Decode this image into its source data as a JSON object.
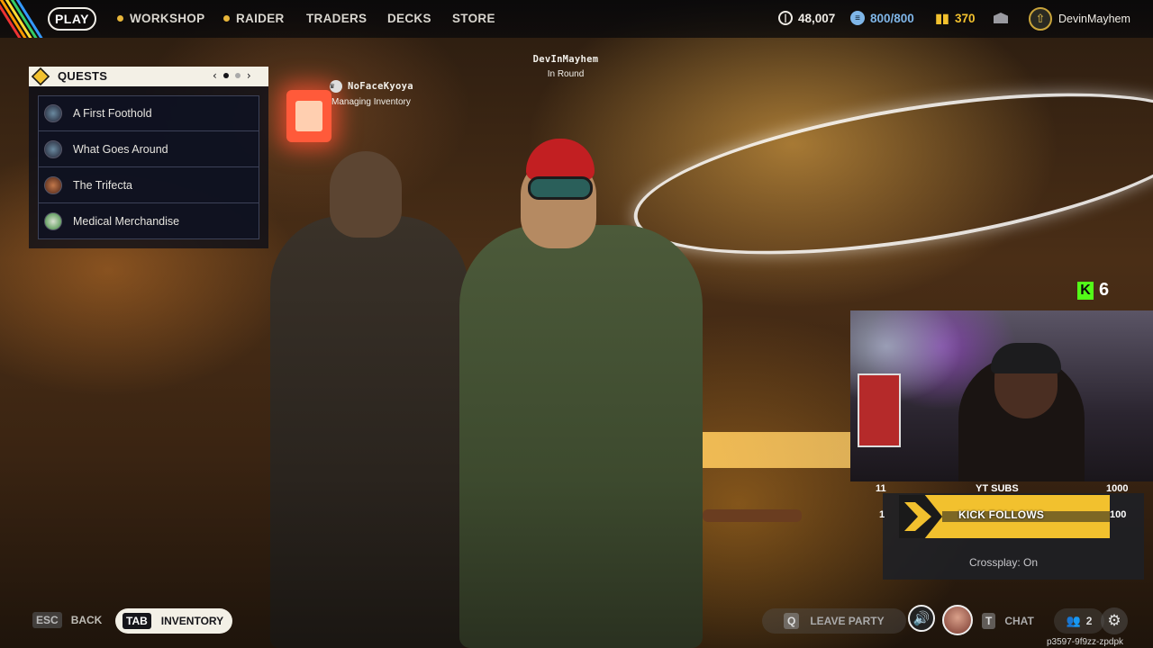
{
  "nav": {
    "play": "PLAY",
    "items": [
      "WORKSHOP",
      "RAIDER",
      "TRADERS",
      "DECKS",
      "STORE"
    ],
    "currency": {
      "coins": "48,007",
      "energy": "800/800",
      "tokens": "370"
    },
    "username": "DevinMayhem",
    "colors": {
      "coins": "#e8e4dc",
      "energy": "#7fb6e8",
      "tokens": "#f2c12e"
    }
  },
  "quests": {
    "title": "QUESTS",
    "prev": "‹",
    "next": "›",
    "items": [
      {
        "label": "A First Foothold",
        "icon": "quest-giver-avatar-icon"
      },
      {
        "label": "What Goes Around",
        "icon": "quest-giver-avatar-icon"
      },
      {
        "label": "The Trifecta",
        "icon": "quest-giver-avatar-icon"
      },
      {
        "label": "Medical Merchandise",
        "icon": "quest-giver-avatar-icon"
      }
    ]
  },
  "players": [
    {
      "name": "NoFaceKyoya",
      "status": "Managing Inventory"
    },
    {
      "name": "DevInMayhem",
      "status": "In Round"
    }
  ],
  "overlay": {
    "kick_count": "6",
    "goals": [
      {
        "left": "11",
        "label": "YT SUBS",
        "right": "1000"
      },
      {
        "left": "1",
        "label": "KICK FOLLOWS",
        "right": "100"
      }
    ],
    "crossplay": "Crossplay: On"
  },
  "bottom": {
    "back_key": "ESC",
    "back_label": "BACK",
    "inventory_key": "TAB",
    "inventory_label": "INVENTORY",
    "leave_key": "Q",
    "leave_label": "LEAVE PARTY",
    "chat_key": "T",
    "chat_label": "CHAT",
    "party_count": "2",
    "session_id": "p3597-9f9zz-zpdpk"
  }
}
